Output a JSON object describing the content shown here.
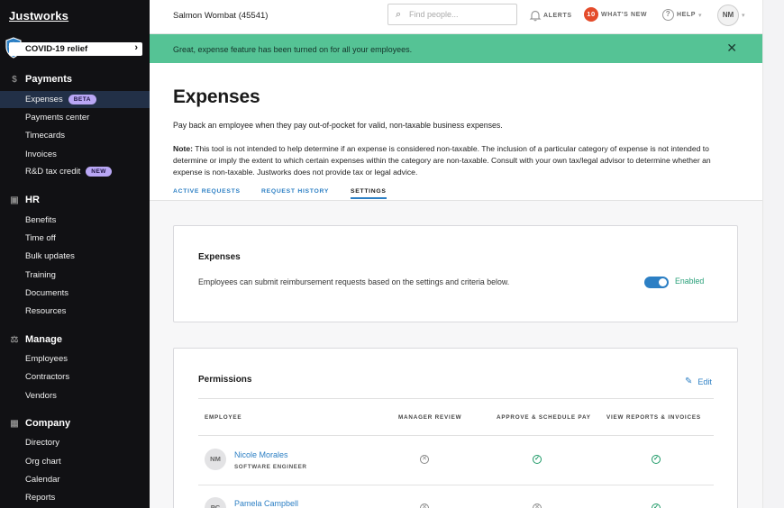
{
  "sidebar": {
    "logo": "Justworks",
    "covid": "COVID-19 relief",
    "sections": [
      {
        "title": "Payments",
        "icon": "dollar-icon",
        "glyph": "$",
        "items": [
          {
            "label": "Expenses",
            "badge": "BETA",
            "active": true
          },
          {
            "label": "Payments center"
          },
          {
            "label": "Timecards"
          },
          {
            "label": "Invoices"
          },
          {
            "label": "R&D tax credit",
            "badge": "NEW"
          }
        ]
      },
      {
        "title": "HR",
        "icon": "briefcase-icon",
        "glyph": "▣",
        "items": [
          {
            "label": "Benefits"
          },
          {
            "label": "Time off"
          },
          {
            "label": "Bulk updates"
          },
          {
            "label": "Training"
          },
          {
            "label": "Documents"
          },
          {
            "label": "Resources"
          }
        ]
      },
      {
        "title": "Manage",
        "icon": "scales-icon",
        "glyph": "⚖",
        "items": [
          {
            "label": "Employees"
          },
          {
            "label": "Contractors"
          },
          {
            "label": "Vendors"
          }
        ]
      },
      {
        "title": "Company",
        "icon": "building-icon",
        "glyph": "▦",
        "items": [
          {
            "label": "Directory"
          },
          {
            "label": "Org chart"
          },
          {
            "label": "Calendar"
          },
          {
            "label": "Reports"
          }
        ]
      }
    ]
  },
  "topbar": {
    "company": "Salmon Wombat (45541)",
    "search_placeholder": "Find people...",
    "alerts": "ALERTS",
    "whats_new_count": "10",
    "whats_new": "WHAT'S NEW",
    "help": "HELP",
    "avatar": "NM"
  },
  "banner": {
    "message": "Great, expense feature has been turned on for all your employees."
  },
  "page": {
    "title": "Expenses",
    "description": "Pay back an employee when they pay out-of-pocket for valid, non-taxable business expenses.",
    "note_label": "Note:",
    "note_text": "This tool is not intended to help determine if an expense is considered non-taxable. The inclusion of a particular category of expense is not intended to determine or imply the extent to which certain expenses within the category are non-taxable. Consult with your own tax/legal advisor to determine whether an expense is non-taxable. Justworks does not provide tax or legal advice.",
    "tabs": [
      {
        "label": "ACTIVE REQUESTS"
      },
      {
        "label": "REQUEST HISTORY"
      },
      {
        "label": "SETTINGS",
        "selected": true
      }
    ]
  },
  "expenses_card": {
    "title": "Expenses",
    "text": "Employees can submit reimbursement requests based on the settings and criteria below.",
    "toggle_state": "Enabled"
  },
  "permissions": {
    "title": "Permissions",
    "edit": "Edit",
    "columns": [
      "EMPLOYEE",
      "MANAGER REVIEW",
      "APPROVE & SCHEDULE PAY",
      "VIEW REPORTS & INVOICES"
    ],
    "rows": [
      {
        "initials": "NM",
        "name": "Nicole Morales",
        "role": "SOFTWARE ENGINEER",
        "manager_review": false,
        "approve_pay": true,
        "view_reports": true
      },
      {
        "initials": "PC",
        "name": "Pamela Campbell",
        "role": "",
        "manager_review": false,
        "approve_pay": false,
        "view_reports": true
      }
    ]
  }
}
